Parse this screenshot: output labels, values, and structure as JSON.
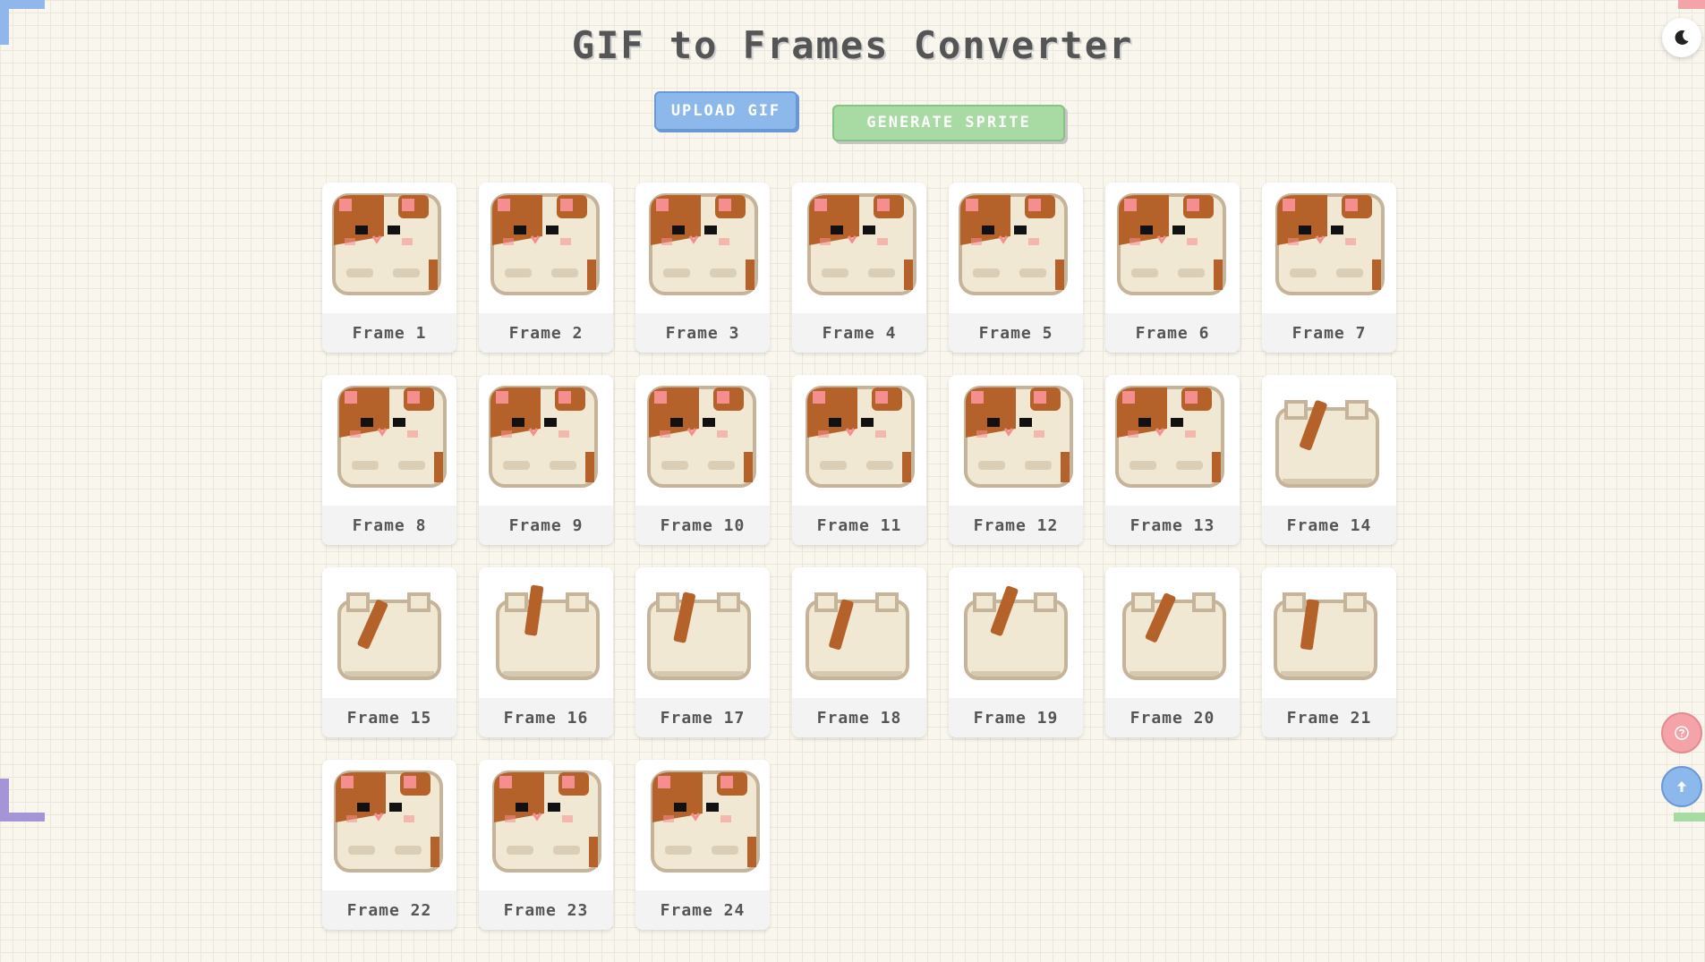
{
  "app": {
    "title": "GIF to Frames Converter",
    "upload_label": "UPLOAD GIF",
    "generate_label": "GENERATE SPRITE",
    "theme_icon": "moon-icon",
    "help_icon": "help-icon",
    "scroll_top_icon": "arrow-up-icon"
  },
  "colors": {
    "upload": "#8cb8ec",
    "generate": "#a8dba4",
    "help": "#f4a3a8",
    "cat_body": "#f1e8d3",
    "cat_outline": "#c5b49a",
    "cat_patch": "#b5622a",
    "cat_cheek": "#f58e8e"
  },
  "frames": [
    {
      "label": "Frame 1",
      "pose": "face"
    },
    {
      "label": "Frame 2",
      "pose": "face"
    },
    {
      "label": "Frame 3",
      "pose": "face"
    },
    {
      "label": "Frame 4",
      "pose": "face"
    },
    {
      "label": "Frame 5",
      "pose": "face"
    },
    {
      "label": "Frame 6",
      "pose": "face"
    },
    {
      "label": "Frame 7",
      "pose": "face"
    },
    {
      "label": "Frame 8",
      "pose": "face"
    },
    {
      "label": "Frame 9",
      "pose": "face"
    },
    {
      "label": "Frame 10",
      "pose": "face"
    },
    {
      "label": "Frame 11",
      "pose": "face"
    },
    {
      "label": "Frame 12",
      "pose": "face"
    },
    {
      "label": "Frame 13",
      "pose": "face"
    },
    {
      "label": "Frame 14",
      "pose": "back"
    },
    {
      "label": "Frame 15",
      "pose": "back"
    },
    {
      "label": "Frame 16",
      "pose": "back"
    },
    {
      "label": "Frame 17",
      "pose": "back"
    },
    {
      "label": "Frame 18",
      "pose": "back"
    },
    {
      "label": "Frame 19",
      "pose": "back"
    },
    {
      "label": "Frame 20",
      "pose": "back"
    },
    {
      "label": "Frame 21",
      "pose": "back"
    },
    {
      "label": "Frame 22",
      "pose": "face"
    },
    {
      "label": "Frame 23",
      "pose": "face"
    },
    {
      "label": "Frame 24",
      "pose": "face"
    }
  ]
}
